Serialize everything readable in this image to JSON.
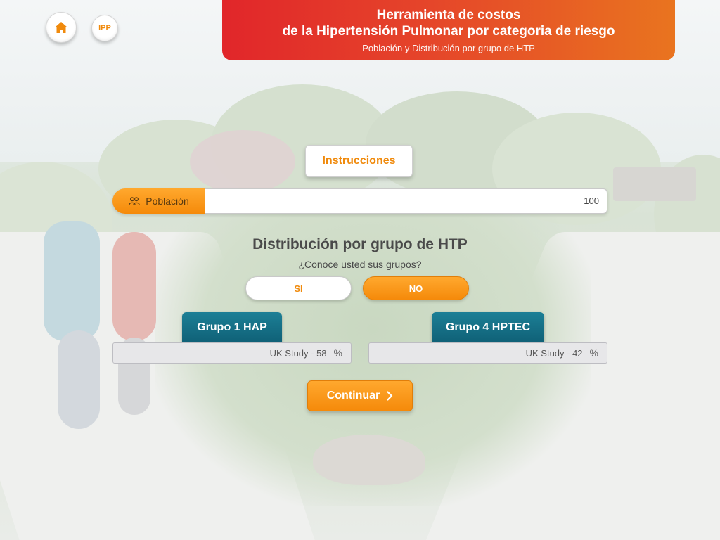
{
  "header": {
    "title_line1": "Herramienta de costos",
    "title_line2": "de la Hipertensión Pulmonar por categoria de riesgo",
    "subtitle": "Población y Distribución por grupo de HTP"
  },
  "nav": {
    "home_icon": "home-icon",
    "ipp_label": "IPP"
  },
  "instructions_label": "Instrucciones",
  "population": {
    "icon": "people-icon",
    "label": "Población",
    "value": "100"
  },
  "distribution": {
    "title": "Distribución por grupo de HTP",
    "question": "¿Conoce usted sus grupos?",
    "yes_label": "SI",
    "no_label": "NO",
    "selected": "NO",
    "groups": [
      {
        "label": "Grupo 1 HAP",
        "value": "UK Study - 58",
        "unit": "%"
      },
      {
        "label": "Grupo 4 HPTEC",
        "value": "UK Study - 42",
        "unit": "%"
      }
    ]
  },
  "continue_label": "Continuar",
  "colors": {
    "header_start": "#e1262a",
    "header_end": "#e9741f",
    "accent_orange": "#f58a0a",
    "group_teal": "#0f6076"
  }
}
